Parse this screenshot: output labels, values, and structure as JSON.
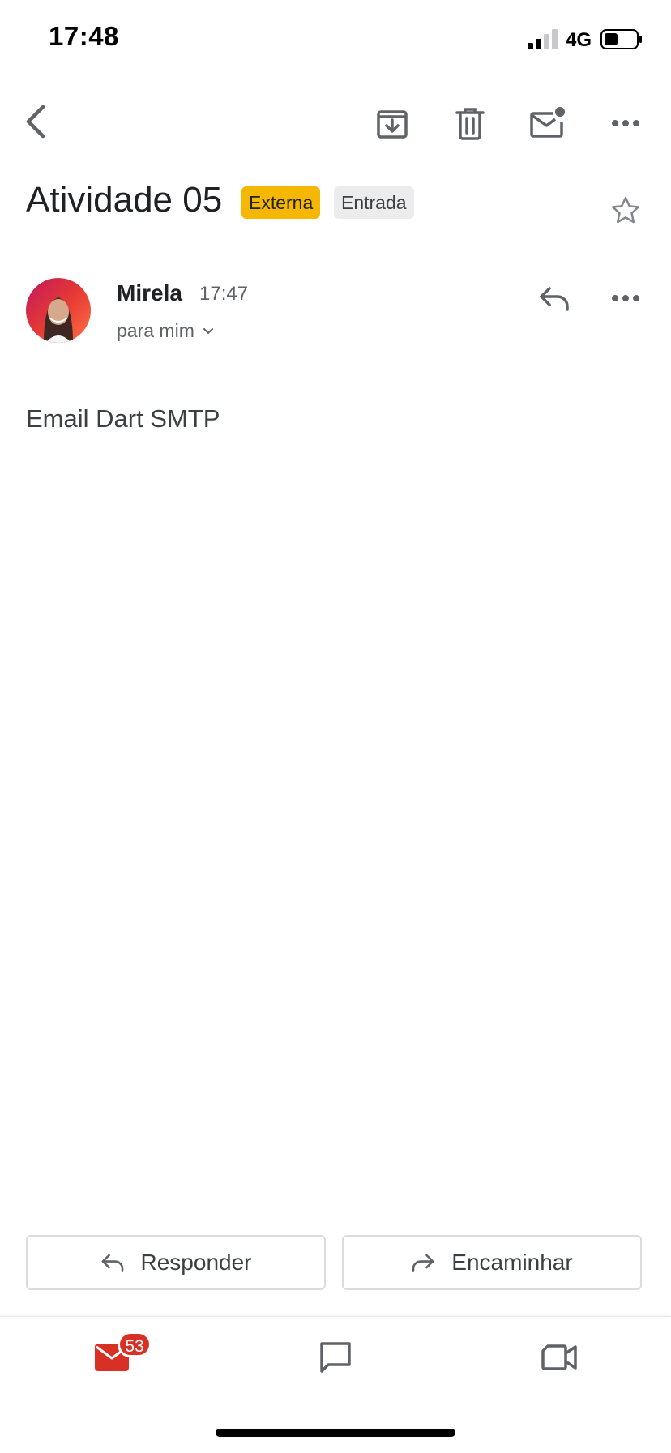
{
  "status_bar": {
    "time": "17:48",
    "network": "4G"
  },
  "toolbar": {
    "icons": [
      "back-arrow-icon",
      "archive-icon",
      "delete-icon",
      "mark-unread-icon",
      "more-icon"
    ]
  },
  "email": {
    "subject": "Atividade 05",
    "labels": [
      {
        "text": "Externa",
        "color": "#f6b700"
      },
      {
        "text": "Entrada",
        "color": "#ececec"
      }
    ],
    "sender_name": "Mirela",
    "sent_time": "17:47",
    "recipient": "para mim",
    "body": "Email Dart SMTP"
  },
  "actions": {
    "reply_label": "Responder",
    "forward_label": "Encaminhar"
  },
  "bottom_nav": {
    "mail_badge": "53",
    "items": [
      "mail-icon",
      "chat-icon",
      "meet-video-icon"
    ]
  },
  "colors": {
    "accent_red": "#d93025",
    "label_yellow": "#f6b700",
    "icon_gray": "#5f6368"
  }
}
